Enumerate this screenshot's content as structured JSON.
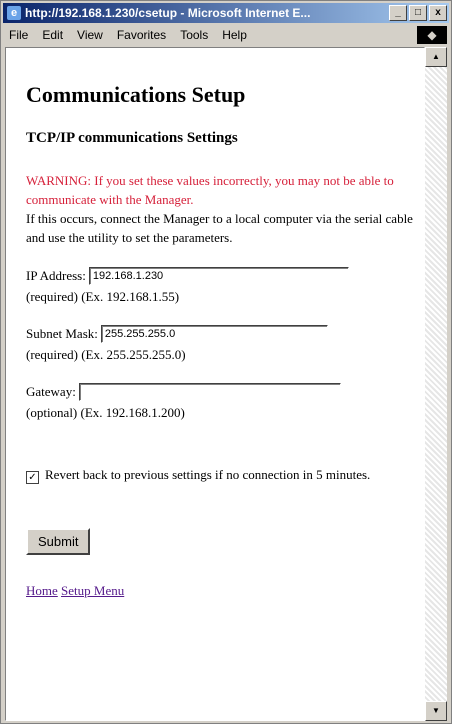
{
  "window": {
    "title": "http://192.168.1.230/csetup - Microsoft Internet E...",
    "min": "_",
    "max": "□",
    "close": "x"
  },
  "menu": [
    "File",
    "Edit",
    "View",
    "Favorites",
    "Tools",
    "Help"
  ],
  "page": {
    "heading": "Communications Setup",
    "subheading": "TCP/IP communications Settings",
    "warning": "WARNING: If you set these values incorrectly, you may not be able to communicate with the Manager.",
    "instructions": "If this occurs, connect the Manager to a local computer via the serial cable and use the utility to set the parameters."
  },
  "form": {
    "ip": {
      "label": "IP Address:",
      "value": "192.168.1.230",
      "hint": "(required) (Ex. 192.168.1.55)"
    },
    "mask": {
      "label": "Subnet Mask:",
      "value": "255.255.255.0",
      "hint": "(required) (Ex. 255.255.255.0)"
    },
    "gateway": {
      "label": "Gateway:",
      "value": "",
      "hint": "(optional) (Ex. 192.168.1.200)"
    },
    "revert": {
      "checked": true,
      "checkmark": "✓",
      "label": "Revert back to previous settings if no connection in 5 minutes."
    },
    "submit_label": "Submit"
  },
  "links": {
    "home": "Home",
    "setup_menu": "Setup Menu"
  }
}
